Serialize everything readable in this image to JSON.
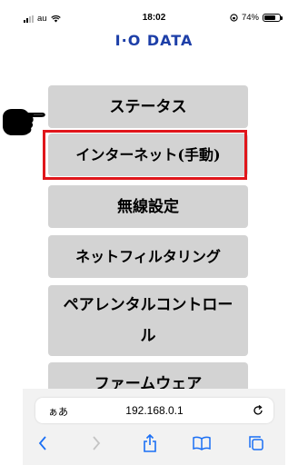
{
  "status_bar": {
    "carrier": "au",
    "time": "18:02",
    "battery_percent": "74%",
    "battery_level": 0.74
  },
  "logo": {
    "text": "I·O DATA",
    "color": "#1d3fa8"
  },
  "menu": {
    "items": [
      {
        "label": "ステータス"
      },
      {
        "label": "インターネット(手動)"
      },
      {
        "label": "無線設定"
      },
      {
        "label": "ネットフィルタリング"
      },
      {
        "label": "ペアレンタルコントロール"
      },
      {
        "label": "ファームウェア"
      }
    ],
    "highlight_color": "#e0161b"
  },
  "safari": {
    "text_size_label": "ぁあ",
    "url": "192.168.0.1",
    "toolbar_icons": [
      "back-icon",
      "forward-icon",
      "share-icon",
      "bookmarks-icon",
      "tabs-icon"
    ]
  }
}
